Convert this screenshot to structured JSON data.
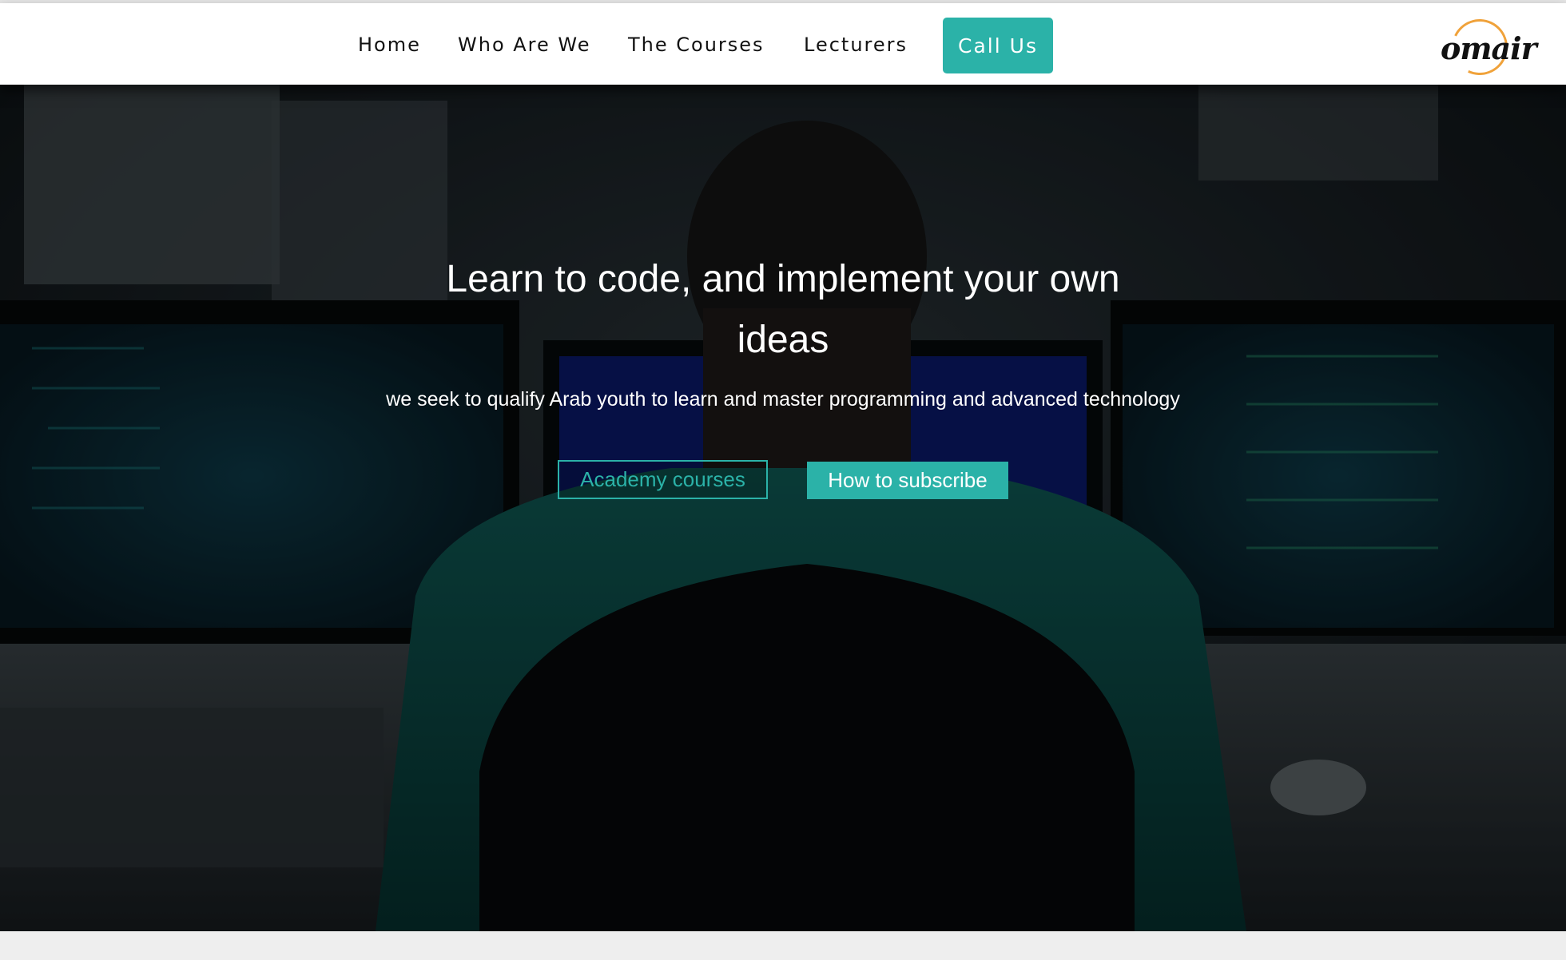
{
  "nav": {
    "items": [
      "Home",
      "Who Are We",
      "The Courses",
      "Lecturers"
    ],
    "cta": "Call Us"
  },
  "logo": {
    "text": "omair"
  },
  "hero": {
    "title": "Learn to code, and implement your own ideas",
    "subtitle": "we seek to qualify Arab youth to learn and master programming and advanced technology",
    "primary_button": "Academy courses",
    "secondary_button": "How to subscribe"
  },
  "colors": {
    "accent": "#2bb2a8",
    "logo_ring": "#f0a23a",
    "navbar_bg": "#ffffff"
  }
}
